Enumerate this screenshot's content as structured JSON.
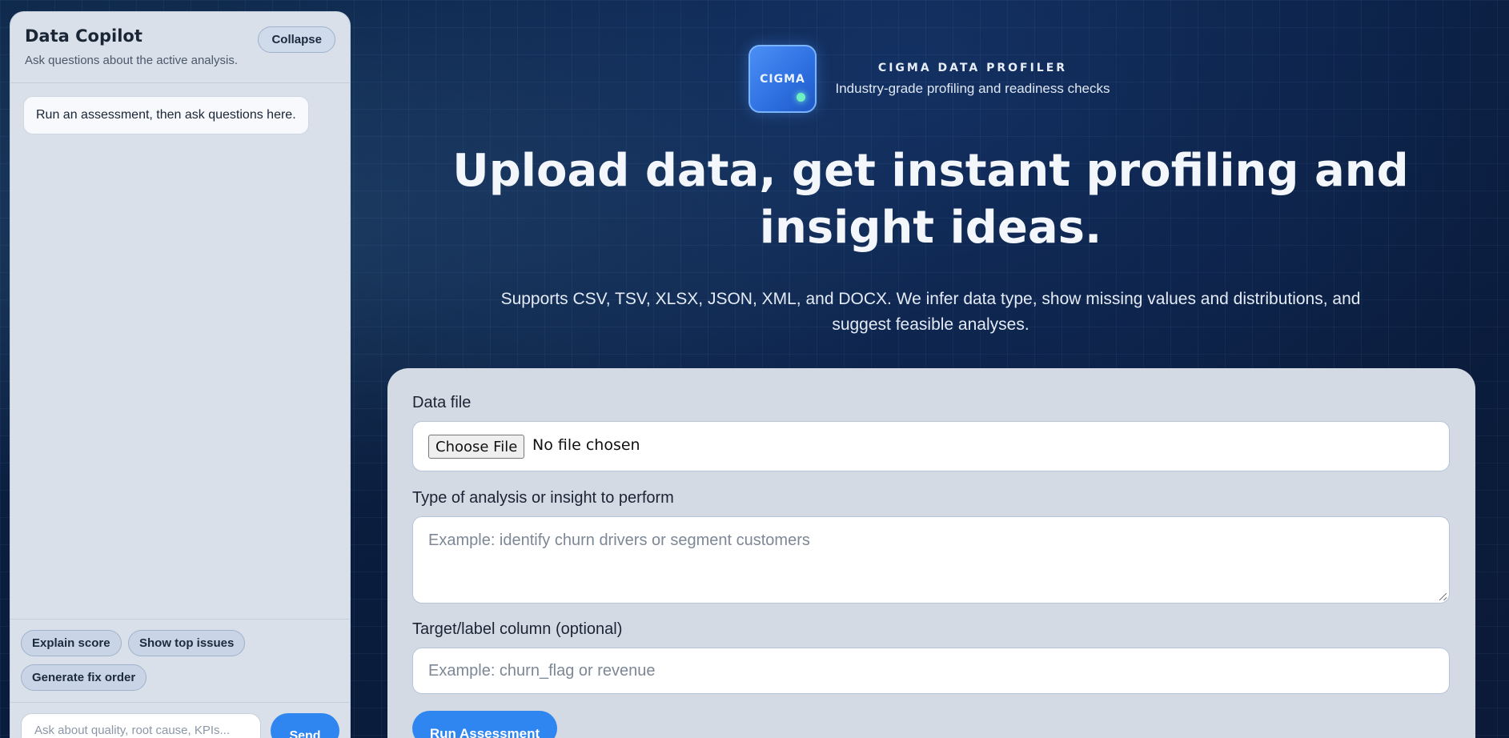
{
  "sidebar": {
    "title": "Data Copilot",
    "subtitle": "Ask questions about the active analysis.",
    "collapse_label": "Collapse",
    "message": "Run an assessment, then ask questions here.",
    "chips": [
      "Explain score",
      "Show top issues",
      "Generate fix order"
    ],
    "ask_placeholder": "Ask about quality, root cause, KPIs...",
    "send_label": "Send"
  },
  "brand": {
    "logo_text": "CIGMA",
    "name": "CIGMA DATA PROFILER",
    "tagline": "Industry-grade profiling and readiness checks"
  },
  "hero": {
    "title": "Upload data, get instant profiling and insight ideas.",
    "subtitle": "Supports CSV, TSV, XLSX, JSON, XML, and DOCX. We infer data type, show missing values and distributions, and suggest feasible analyses."
  },
  "form": {
    "file_label": "Data file",
    "file_button": "Choose File",
    "file_status": "No file chosen",
    "analysis_label": "Type of analysis or insight to perform",
    "analysis_placeholder": "Example: identify churn drivers or segment customers",
    "target_label": "Target/label column (optional)",
    "target_placeholder": "Example: churn_flag or revenue",
    "run_label": "Run Assessment"
  },
  "colors": {
    "accent": "#2f86f0",
    "background": "#0a1b3a",
    "panel": "#d9e0ea"
  }
}
